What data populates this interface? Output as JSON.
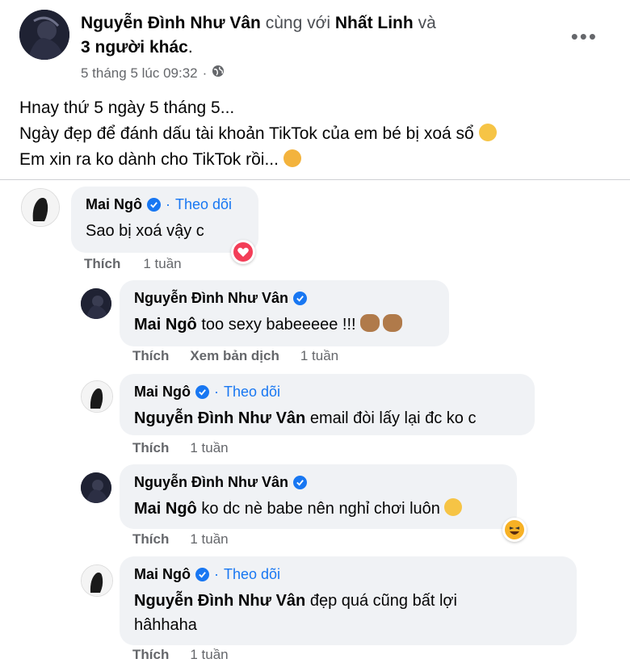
{
  "post": {
    "author": "Nguyễn Đình Như Vân",
    "with_text": "cùng với",
    "tagged": "Nhất Linh",
    "and_text": "và",
    "others": "3 người khác",
    "period": ".",
    "timestamp": "5 tháng 5 lúc 09:32",
    "privacy_sep": "·",
    "privacy_icon": "globe-icon",
    "more_label": "•••",
    "lines": [
      "Hnay thứ 5 ngày 5 tháng 5...",
      "Ngày đẹp để đánh dấu tài khoản TikTok của em bé bị xoá sổ",
      "Em xin ra ko dành cho TikTok rồi..."
    ]
  },
  "comments": [
    {
      "name": "Mai Ngô",
      "sep": "·",
      "follow": "Theo dõi",
      "text": "Sao bị xoá vậy c",
      "like": "Thích",
      "time": "1 tuần",
      "reaction": "love"
    },
    {
      "name": "Nguyễn Đình Như Vân",
      "mention": "Mai Ngô",
      "text": " too sexy babeeeee !!!",
      "like": "Thích",
      "translate": "Xem bản dịch",
      "time": "1 tuần"
    },
    {
      "name": "Mai Ngô",
      "sep": "·",
      "follow": "Theo dõi",
      "mention": "Nguyễn Đình Như Vân",
      "text": " email đòi lấy lại đc ko c",
      "like": "Thích",
      "time": "1 tuần"
    },
    {
      "name": "Nguyễn Đình Như Vân",
      "mention": "Mai Ngô",
      "text": " ko dc nè babe nên nghỉ chơi luôn",
      "like": "Thích",
      "time": "1 tuần",
      "reaction": "haha"
    },
    {
      "name": "Mai Ngô",
      "sep": "·",
      "follow": "Theo dõi",
      "mention": "Nguyễn Đình Như Vân",
      "text": " đẹp quá cũng bất lợi",
      "text2": "hâhhaha",
      "like": "Thích",
      "time": "1 tuần"
    }
  ],
  "colors": {
    "link_blue": "#1877f2",
    "bubble_bg": "#f0f2f5",
    "meta_gray": "#65676b",
    "love_red": "#f33e58"
  }
}
